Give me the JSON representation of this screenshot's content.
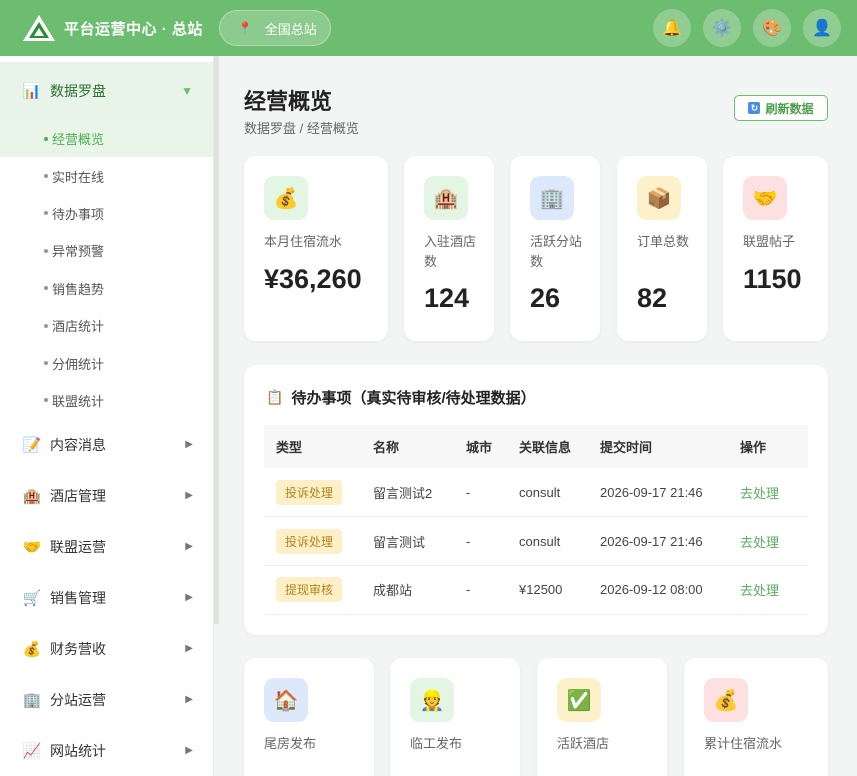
{
  "header": {
    "brand": "平台运营中心 · 总站",
    "location": "全国总站",
    "icons": [
      "bell-icon",
      "gear-icon",
      "palette-icon",
      "user-avatar-icon"
    ]
  },
  "sidebar": {
    "sections": [
      {
        "label": "数据罗盘",
        "icon": "chart-icon",
        "open": true,
        "items": [
          "经营概览",
          "实时在线",
          "待办事项",
          "异常预警",
          "销售趋势",
          "酒店统计",
          "分佣统计",
          "联盟统计"
        ]
      },
      {
        "label": "内容消息",
        "icon": "memo-icon"
      },
      {
        "label": "酒店管理",
        "icon": "hotel-icon"
      },
      {
        "label": "联盟运营",
        "icon": "handshake-icon"
      },
      {
        "label": "销售管理",
        "icon": "cart-icon"
      },
      {
        "label": "财务营收",
        "icon": "money-bag-icon"
      },
      {
        "label": "分站运营",
        "icon": "building-icon"
      },
      {
        "label": "网站统计",
        "icon": "line-chart-icon"
      }
    ],
    "active_item": "经营概览"
  },
  "page": {
    "title": "经营概览",
    "breadcrumb": "数据罗盘 / 经营概览",
    "refresh_label": "刷新数据"
  },
  "stats": [
    {
      "label": "本月住宿流水",
      "value": "¥36,260",
      "icon": "money-bag-icon",
      "bg": "#e2f6e3"
    },
    {
      "label": "入驻酒店数",
      "value": "124",
      "icon": "hotel-icon",
      "bg": "#e2f6e3"
    },
    {
      "label": "活跃分站数",
      "value": "26",
      "icon": "building-icon",
      "bg": "#dde9fb"
    },
    {
      "label": "订单总数",
      "value": "82",
      "icon": "package-icon",
      "bg": "#fdf1cc"
    },
    {
      "label": "联盟帖子",
      "value": "1150",
      "icon": "handshake-icon",
      "bg": "#fde0e0"
    }
  ],
  "todo": {
    "title": "待办事项（真实待审核/待处理数据）",
    "columns": [
      "类型",
      "名称",
      "城市",
      "关联信息",
      "提交时间",
      "操作"
    ],
    "rows": [
      {
        "type": "投诉处理",
        "name": "留言测试2",
        "city": "-",
        "info": "consult",
        "time": "2026-09-17 21:46",
        "action": "去处理"
      },
      {
        "type": "投诉处理",
        "name": "留言测试",
        "city": "-",
        "info": "consult",
        "time": "2026-09-17 21:46",
        "action": "去处理"
      },
      {
        "type": "提现审核",
        "name": "成都站",
        "city": "-",
        "info": "¥12500",
        "time": "2026-09-12 08:00",
        "action": "去处理"
      }
    ]
  },
  "stats2": [
    {
      "label": "尾房发布",
      "icon": "house-icon",
      "bg": "#dde9fb"
    },
    {
      "label": "临工发布",
      "icon": "worker-icon",
      "bg": "#e2f6e3"
    },
    {
      "label": "活跃酒店",
      "icon": "check-icon",
      "bg": "#fdf1cc"
    },
    {
      "label": "累计住宿流水",
      "icon": "money-bag-icon",
      "bg": "#fde0e0"
    }
  ]
}
